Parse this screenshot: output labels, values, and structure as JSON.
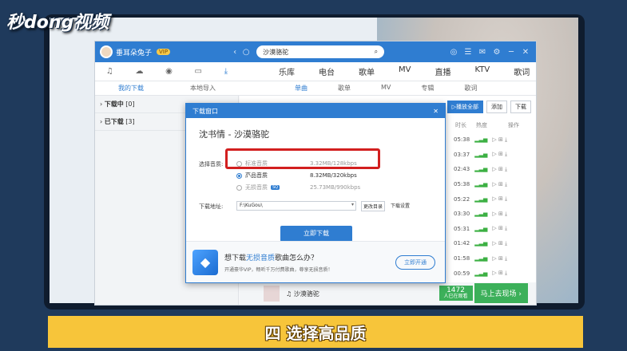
{
  "watermark": "秒dong视频",
  "app": {
    "titlebar": {
      "username": "垂耳朵兔子",
      "vip": "VIP",
      "search_value": "沙漠骆驼"
    },
    "nav_main": [
      "乐库",
      "电台",
      "歌单",
      "MV",
      "直播",
      "KTV",
      "歌词"
    ],
    "sub_left": [
      "我的下载",
      "本地导入"
    ],
    "sub_main": [
      "单曲",
      "歌单",
      "MV",
      "专辑",
      "歌词"
    ],
    "sidebar": [
      {
        "label": "下载中",
        "count": "[0]"
      },
      {
        "label": "已下载",
        "count": "[3]"
      }
    ],
    "actions": {
      "play_all": "▷播放全部",
      "add": "添加",
      "download": "下载"
    },
    "col_headers": [
      "时长",
      "热度",
      "操作"
    ],
    "durations": [
      "05:38",
      "03:37",
      "02:43",
      "05:38",
      "05:22",
      "03:30",
      "05:31",
      "01:42",
      "01:58",
      "00:59"
    ],
    "promo_song": "♫ 沙漠骆驼",
    "live": {
      "count": "1472",
      "sub": "人已在观看",
      "button": "马上去现场 ›"
    }
  },
  "modal": {
    "title": "下载窗口",
    "song": "沈书情 - 沙漠骆驼",
    "quality_label": "选择音质:",
    "options": [
      {
        "name": "标准音质",
        "size": "3.32MB/128kbps",
        "selected": false
      },
      {
        "name": "高品音质",
        "size": "8.32MB/320kbps",
        "selected": true
      },
      {
        "name": "无损音质",
        "badge": "SQ",
        "size": "25.73MB/990kbps",
        "selected": false
      }
    ],
    "path_label": "下载地址:",
    "path_value": "F:\\KuGou\\",
    "change_dir": "更改目录",
    "settings": "下载设置",
    "download_button": "立即下载",
    "footer": {
      "headline_pre": "想下载",
      "headline_hl": "无损音质",
      "headline_post": "歌曲怎么办？",
      "sub": "开通豪华VIP，畅听千万付费歌曲，尊享无损音质！",
      "button": "立即开通"
    }
  },
  "caption": "四  选择高品质"
}
